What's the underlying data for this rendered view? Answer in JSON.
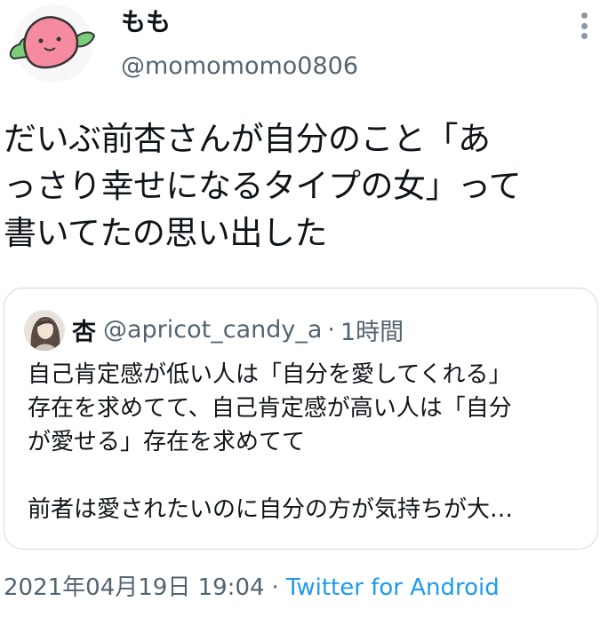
{
  "author": {
    "name": "もも",
    "handle": "@momomomo0806"
  },
  "tweet": {
    "text": "だいぶ前杏さんが自分のこと「あ\nっさり幸せになるタイプの女」って\n書いてたの思い出した"
  },
  "quoted_tweet": {
    "name": "杏",
    "handle": "@apricot_candy_a",
    "separator": "·",
    "time": "1時間",
    "text": "自己肯定感が低い人は「自分を愛してくれる」\n存在を求めてて、自己肯定感が高い人は「自分\nが愛せる」存在を求めてて\n\n前者は愛されたいのに自分の方が気持ちが大…"
  },
  "meta": {
    "date": "2021年04月19日 19:04",
    "separator": "·",
    "client": "Twitter for Android"
  },
  "colors": {
    "secondary_text": "#536471",
    "link": "#1d9bf0",
    "border": "#cfd9de",
    "avatar_peach": "#f68aa0",
    "avatar_leaf": "#7ccc7a"
  },
  "icons": {
    "more": "more-vertical-icon"
  }
}
